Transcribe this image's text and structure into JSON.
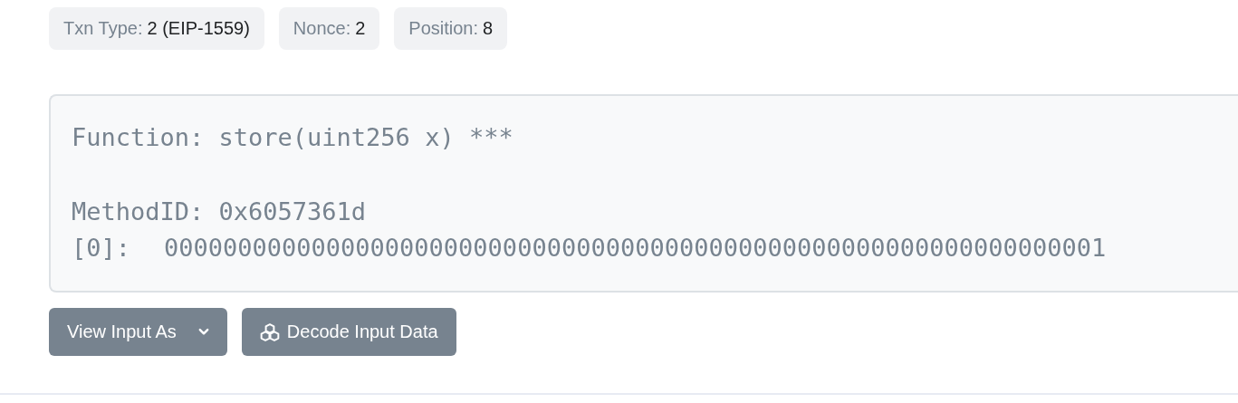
{
  "badges": [
    {
      "label": "Txn Type:",
      "value": "2 (EIP-1559)"
    },
    {
      "label": "Nonce:",
      "value": "2"
    },
    {
      "label": "Position:",
      "value": "8"
    }
  ],
  "input_data": {
    "function": "Function: store(uint256 x) ***",
    "method_id": "MethodID: 0x6057361d",
    "params": [
      {
        "index": "[0]:",
        "value": "0000000000000000000000000000000000000000000000000000000000000001"
      }
    ]
  },
  "buttons": [
    {
      "kind": "dropdown",
      "label": "View Input As"
    },
    {
      "kind": "decode",
      "label": "Decode Input Data"
    }
  ]
}
